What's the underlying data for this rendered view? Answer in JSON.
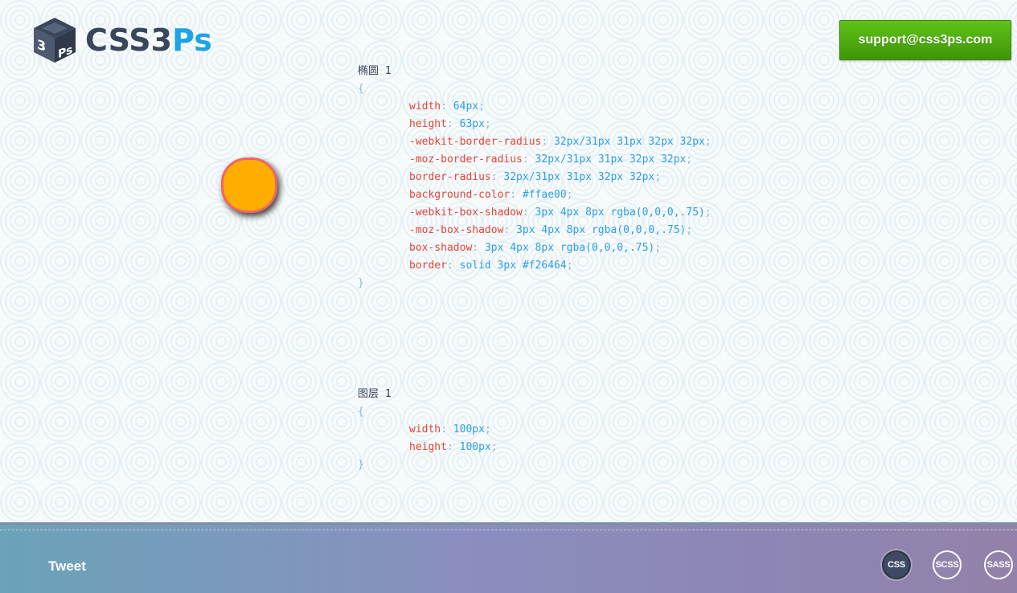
{
  "logo": {
    "text_dark": "CSS3",
    "text_blue": "Ps",
    "icon": "ps-cube-icon"
  },
  "support": {
    "label": "support@css3ps.com"
  },
  "preview": {
    "fill": "#ffae00",
    "border": "#f26464"
  },
  "blocks": [
    {
      "title": "椭圆 1",
      "open": "{",
      "close": "}",
      "rules": [
        {
          "prop": "width",
          "val": "64px"
        },
        {
          "prop": "height",
          "val": "63px"
        },
        {
          "prop": "-webkit-border-radius",
          "val": "32px/31px 31px 32px 32px"
        },
        {
          "prop": "-moz-border-radius",
          "val": "32px/31px 31px 32px 32px"
        },
        {
          "prop": "border-radius",
          "val": "32px/31px 31px 32px 32px"
        },
        {
          "prop": "background-color",
          "val": "#ffae00"
        },
        {
          "prop": "-webkit-box-shadow",
          "val": "3px 4px 8px rgba(0,0,0,.75)"
        },
        {
          "prop": "-moz-box-shadow",
          "val": "3px 4px 8px rgba(0,0,0,.75)"
        },
        {
          "prop": "box-shadow",
          "val": "3px 4px 8px rgba(0,0,0,.75)"
        },
        {
          "prop": "border",
          "val": "solid 3px #f26464"
        }
      ]
    },
    {
      "title": "图层 1",
      "open": "{",
      "close": "}",
      "rules": [
        {
          "prop": "width",
          "val": "100px"
        },
        {
          "prop": "height",
          "val": "100px"
        }
      ]
    }
  ],
  "footer": {
    "tweet": "Tweet",
    "formats": [
      {
        "label": "CSS",
        "active": true
      },
      {
        "label": "SCSS",
        "active": false
      },
      {
        "label": "SASS",
        "active": false
      }
    ]
  }
}
